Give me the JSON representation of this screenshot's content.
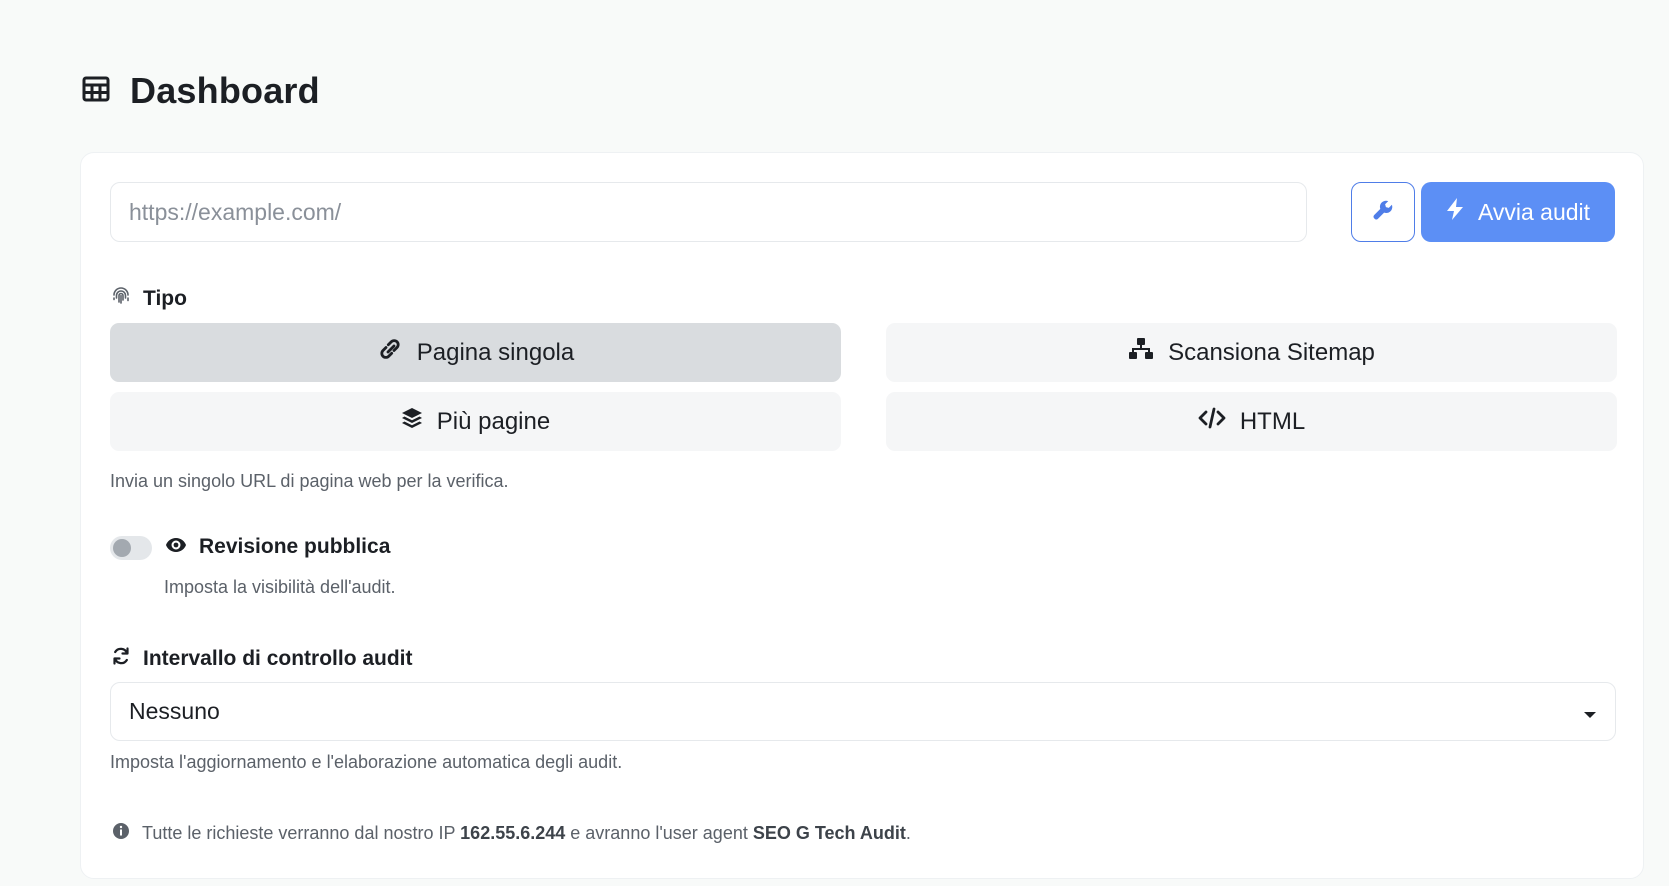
{
  "header": {
    "title": "Dashboard",
    "icon": "table-icon"
  },
  "audit_form": {
    "url_placeholder": "https://example.com/",
    "url_value": "",
    "tools_icon": "wrench-icon",
    "start_label": "Avvia audit",
    "start_icon": "bolt-icon",
    "accent_color": "#5c8ff5"
  },
  "type_section": {
    "label": "Tipo",
    "icon": "fingerprint-icon",
    "options": [
      {
        "label": "Pagina singola",
        "icon": "link-icon",
        "selected": true
      },
      {
        "label": "Scansiona Sitemap",
        "icon": "sitemap-icon",
        "selected": false
      },
      {
        "label": "Più pagine",
        "icon": "layers-icon",
        "selected": false
      },
      {
        "label": "HTML",
        "icon": "code-icon",
        "selected": false
      }
    ],
    "help": "Invia un singolo URL di pagina web per la verifica."
  },
  "public_review": {
    "label": "Revisione pubblica",
    "icon": "eye-icon",
    "enabled": false,
    "help": "Imposta la visibilità dell'audit."
  },
  "interval": {
    "label": "Intervallo di controllo audit",
    "icon": "refresh-icon",
    "selected": "Nessuno",
    "help": "Imposta l'aggiornamento e l'elaborazione automatica degli audit."
  },
  "notice": {
    "icon": "info-circle-icon",
    "prefix": "Tutte le richieste verranno dal nostro IP ",
    "ip": "162.55.6.244",
    "middle": " e avranno l'user agent ",
    "user_agent": "SEO G Tech Audit",
    "suffix": "."
  }
}
